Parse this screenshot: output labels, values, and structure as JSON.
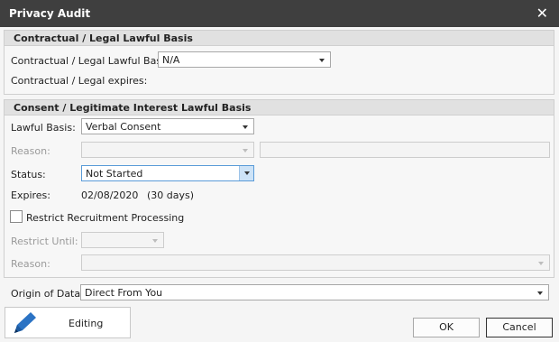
{
  "window": {
    "title": "Privacy Audit"
  },
  "contractual": {
    "header": "Contractual / Legal Lawful Basis",
    "basis_label": "Contractual / Legal Lawful Basis:",
    "basis_value": "N/A",
    "expires_label": "Contractual / Legal expires:"
  },
  "consent": {
    "header": "Consent / Legitimate Interest Lawful Basis",
    "lawful_basis_label": "Lawful Basis:",
    "lawful_basis_value": "Verbal Consent",
    "reason_label": "Reason:",
    "reason_value": "",
    "reason_text": "",
    "status_label": "Status:",
    "status_value": "Not Started",
    "expires_label": "Expires:",
    "expires_date": "02/08/2020",
    "expires_days": "(30 days)",
    "restrict_label": "Restrict Recruitment Processing",
    "restrict_checked": false,
    "restrict_until_label": "Restrict Until:",
    "restrict_until_value": "",
    "restrict_reason_label": "Reason:",
    "restrict_reason_value": ""
  },
  "origin": {
    "label": "Origin of Data:",
    "value": "Direct From You"
  },
  "footer": {
    "editing_label": "Editing",
    "ok_label": "OK",
    "cancel_label": "Cancel"
  },
  "icons": {
    "close": "close-icon",
    "edit": "pencil-icon",
    "dropdown": "chevron-down-icon"
  },
  "colors": {
    "titlebar": "#3f3f3f",
    "pencil": "#2b73c4",
    "active_border": "#5a9bd8"
  }
}
